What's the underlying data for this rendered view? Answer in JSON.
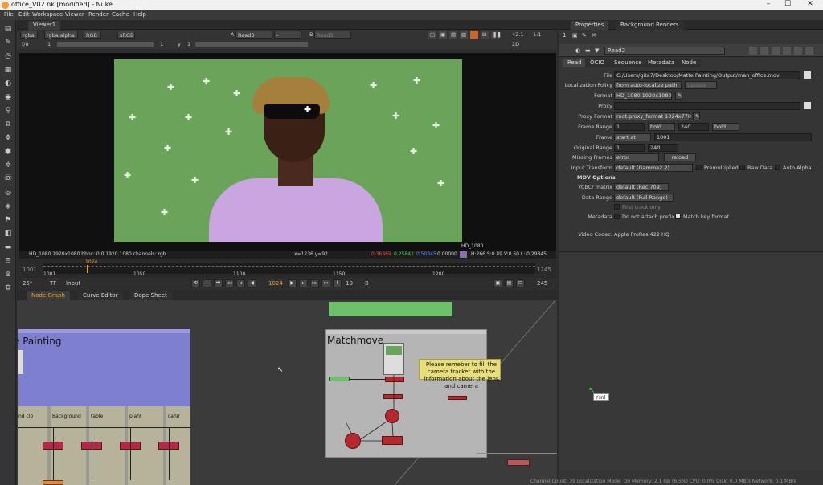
{
  "window": {
    "title": "office_V02.nk [modified] - Nuke"
  },
  "menu": [
    "File",
    "Edit",
    "Workspace",
    "Viewer",
    "Render",
    "Cache",
    "Help"
  ],
  "viewer": {
    "tab": "Viewer1",
    "channels": "rgba",
    "alpha": "rgba.alpha",
    "display": "RGB",
    "lut": "sRGB",
    "input_a_label": "A",
    "input_a": "Read3",
    "input_b_label": "B",
    "input_b": "Read3",
    "input_sep": "-",
    "fstop": "f/8",
    "frame_step": "1",
    "gain_label": "1",
    "y_label": "y",
    "gamma_val": "1",
    "zoom": "42.1",
    "ratio": "1:1",
    "mode": "2D",
    "corner_label": "HD_1080",
    "info_left": "HD_1080 1920x1080  bbox: 0 0 1920 1080 channels: rgb",
    "info_xy": "x=1236 y=92",
    "info_r": "0.36369",
    "info_g": "0.25842",
    "info_b": "0.50345",
    "info_a": "0.00000",
    "info_hsv": "H:266 S:0.49 V:0.50  L: 0.29845"
  },
  "timeline": {
    "start": "1001",
    "end": "1245",
    "current": "1024",
    "ticks": [
      "1001",
      "1050",
      "1100",
      "1150",
      "1200",
      "1245"
    ],
    "fps": "25*",
    "tf": "TF",
    "range_mode": "Input",
    "step": "10",
    "increment": "8",
    "end_frame": "245"
  },
  "node_panel": {
    "tabs": [
      "Node Graph",
      "Curve Editor",
      "Dope Sheet"
    ],
    "backdrop_left_title": "e Painting",
    "backdrop_right_title": "Matchmove",
    "sticky_note": "Please remeber to fill the camera tracker with the information about the lens and camera",
    "columns": [
      "nd clo",
      "Background",
      "table",
      "plant",
      "cahir"
    ],
    "tooltip": "Ysnl"
  },
  "properties": {
    "tabs": [
      "Properties",
      "Background Renders"
    ],
    "node_name": "Read2",
    "subtabs": [
      "Read",
      "OCIO",
      "Sequence",
      "Metadata",
      "Node"
    ],
    "file_label": "File",
    "file": "C:/Users/gita7/Desktop/Matte Painting/Output/man_office.mov",
    "localization_label": "Localization Policy",
    "localization": "from auto-localize path",
    "update_btn": "Update",
    "format_label": "Format",
    "format": "HD_1080 1920x1080",
    "proxy_label": "Proxy",
    "proxy_format_label": "Proxy Format",
    "proxy_format": "root.proxy_format 1024x778",
    "frame_range_label": "Frame Range",
    "frame_range_start": "1",
    "frame_range_before": "hold",
    "frame_range_end": "240",
    "frame_range_after": "hold",
    "frame_label": "Frame",
    "frame_mode": "start at",
    "frame_value": "1001",
    "original_range_label": "Original Range",
    "original_start": "1",
    "original_end": "240",
    "missing_frames_label": "Missing Frames",
    "missing_frames": "error",
    "reload_btn": "reload",
    "input_transform_label": "Input Transform",
    "input_transform": "default (Gamma2.2)",
    "premultiplied": "Premultiplied",
    "raw_data": "Raw Data",
    "auto_alpha": "Auto Alpha",
    "mov_options": "MOV Options",
    "ycbcr_label": "YCbCr matrix",
    "ycbcr": "default (Rec 709)",
    "data_range_label": "Data Range",
    "data_range": "default (Full Range)",
    "first_track_only": "First track only",
    "metadata_label": "Metadata",
    "do_not_attach": "Do not attach prefix",
    "match_key": "Match key format",
    "video_codec_label": "Video Codec:",
    "video_codec": "Apple ProRes 422 HQ"
  },
  "statusbar": "Channel Count: 39  Localization Mode: On  Memory: 2.1 GB (6.5%)  CPU: 0.0%  Disk: 0.0 MB/s  Network: 0.1 MB/s",
  "colors": {
    "accent": "#f0a030",
    "green_screen": "#6aa35a",
    "backdrop_blue": "#7f7fd0",
    "backdrop_gray": "#b5b5b5",
    "node_red": "#b5282b",
    "sticky": "#e8df7a"
  }
}
